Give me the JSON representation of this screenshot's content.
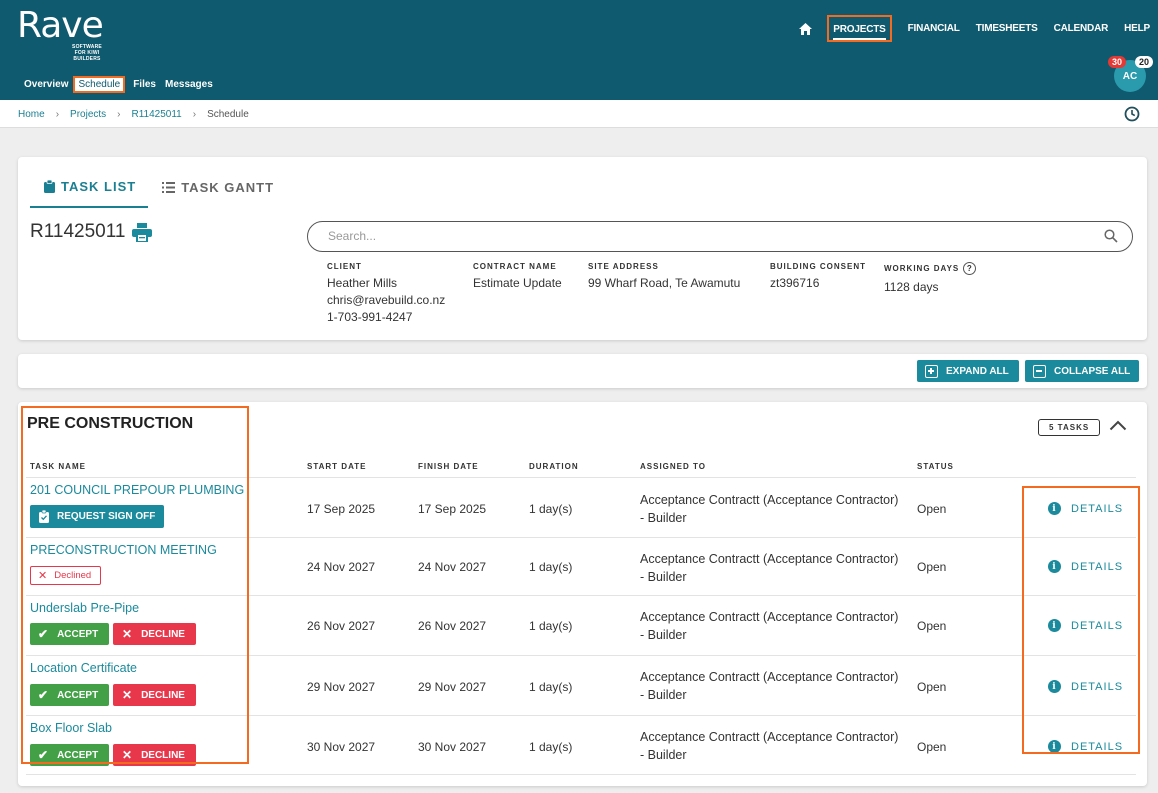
{
  "logo": {
    "main": "Rave",
    "sub": "SOFTWARE FOR KIWI BUILDERS"
  },
  "topnav": {
    "items": [
      "PROJECTS",
      "FINANCIAL",
      "TIMESHEETS",
      "CALENDAR",
      "HELP"
    ],
    "active": "PROJECTS"
  },
  "subnav": {
    "items": [
      "Overview",
      "Schedule",
      "Files",
      "Messages"
    ],
    "active": "Schedule"
  },
  "user": {
    "initials": "AC",
    "badge_red": "30",
    "badge_white": "20"
  },
  "breadcrumb": [
    "Home",
    "Projects",
    "R11425011",
    "Schedule"
  ],
  "tabs": {
    "task_list": "TASK LIST",
    "task_gantt": "TASK GANTT"
  },
  "project": {
    "id": "R11425011",
    "search_placeholder": "Search...",
    "client_label": "CLIENT",
    "client_name": "Heather Mills",
    "client_email": "chris@ravebuild.co.nz",
    "client_phone": "1-703-991-4247",
    "contract_label": "CONTRACT NAME",
    "contract_name": "Estimate Update",
    "address_label": "SITE ADDRESS",
    "address": "99 Wharf Road, Te Awamutu",
    "consent_label": "BUILDING CONSENT",
    "consent": "zt396716",
    "working_label": "WORKING DAYS",
    "working_days": "1128 days"
  },
  "actions": {
    "expand_all": "EXPAND ALL",
    "collapse_all": "COLLAPSE ALL"
  },
  "section": {
    "title": "PRE CONSTRUCTION",
    "task_count": "5 TASKS",
    "columns": [
      "TASK NAME",
      "START DATE",
      "FINISH DATE",
      "DURATION",
      "ASSIGNED TO",
      "STATUS"
    ],
    "details_label": "DETAILS",
    "accept_label": "ACCEPT",
    "decline_label": "DECLINE",
    "request_label": "REQUEST SIGN OFF",
    "declined_label": "Declined",
    "tasks": [
      {
        "name": "201 COUNCIL PREPOUR PLUMBING",
        "start": "17 Sep 2025",
        "finish": "17 Sep 2025",
        "duration": "1 day(s)",
        "assigned_1": "Acceptance Contractt (Acceptance Contractor)",
        "assigned_2": "- Builder",
        "status": "Open"
      },
      {
        "name": "PRECONSTRUCTION MEETING",
        "start": "24 Nov 2027",
        "finish": "24 Nov 2027",
        "duration": "1 day(s)",
        "assigned_1": "Acceptance Contractt (Acceptance Contractor)",
        "assigned_2": "- Builder",
        "status": "Open"
      },
      {
        "name": "Underslab Pre-Pipe",
        "start": "26 Nov 2027",
        "finish": "26 Nov 2027",
        "duration": "1 day(s)",
        "assigned_1": "Acceptance Contractt (Acceptance Contractor)",
        "assigned_2": "- Builder",
        "status": "Open"
      },
      {
        "name": "Location Certificate",
        "start": "29 Nov 2027",
        "finish": "29 Nov 2027",
        "duration": "1 day(s)",
        "assigned_1": "Acceptance Contractt (Acceptance Contractor)",
        "assigned_2": "- Builder",
        "status": "Open"
      },
      {
        "name": "Box Floor Slab",
        "start": "30 Nov 2027",
        "finish": "30 Nov 2027",
        "duration": "1 day(s)",
        "assigned_1": "Acceptance Contractt (Acceptance Contractor)",
        "assigned_2": "- Builder",
        "status": "Open"
      }
    ]
  },
  "colors": {
    "header": "#0f5a6e",
    "accent": "#1a8a9c",
    "accept": "#43a047",
    "decline": "#e8374a",
    "highlight": "#f26b21"
  }
}
